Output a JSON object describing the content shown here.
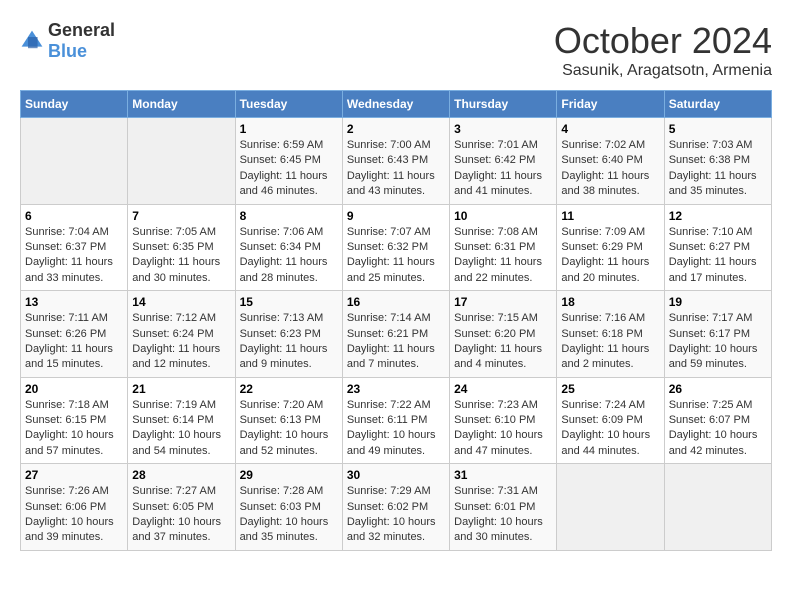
{
  "logo": {
    "general": "General",
    "blue": "Blue"
  },
  "title": "October 2024",
  "subtitle": "Sasunik, Aragatsotn, Armenia",
  "days_header": [
    "Sunday",
    "Monday",
    "Tuesday",
    "Wednesday",
    "Thursday",
    "Friday",
    "Saturday"
  ],
  "weeks": [
    [
      {
        "day": "",
        "empty": true
      },
      {
        "day": "",
        "empty": true
      },
      {
        "day": "1",
        "sunrise": "Sunrise: 6:59 AM",
        "sunset": "Sunset: 6:45 PM",
        "daylight": "Daylight: 11 hours and 46 minutes."
      },
      {
        "day": "2",
        "sunrise": "Sunrise: 7:00 AM",
        "sunset": "Sunset: 6:43 PM",
        "daylight": "Daylight: 11 hours and 43 minutes."
      },
      {
        "day": "3",
        "sunrise": "Sunrise: 7:01 AM",
        "sunset": "Sunset: 6:42 PM",
        "daylight": "Daylight: 11 hours and 41 minutes."
      },
      {
        "day": "4",
        "sunrise": "Sunrise: 7:02 AM",
        "sunset": "Sunset: 6:40 PM",
        "daylight": "Daylight: 11 hours and 38 minutes."
      },
      {
        "day": "5",
        "sunrise": "Sunrise: 7:03 AM",
        "sunset": "Sunset: 6:38 PM",
        "daylight": "Daylight: 11 hours and 35 minutes."
      }
    ],
    [
      {
        "day": "6",
        "sunrise": "Sunrise: 7:04 AM",
        "sunset": "Sunset: 6:37 PM",
        "daylight": "Daylight: 11 hours and 33 minutes."
      },
      {
        "day": "7",
        "sunrise": "Sunrise: 7:05 AM",
        "sunset": "Sunset: 6:35 PM",
        "daylight": "Daylight: 11 hours and 30 minutes."
      },
      {
        "day": "8",
        "sunrise": "Sunrise: 7:06 AM",
        "sunset": "Sunset: 6:34 PM",
        "daylight": "Daylight: 11 hours and 28 minutes."
      },
      {
        "day": "9",
        "sunrise": "Sunrise: 7:07 AM",
        "sunset": "Sunset: 6:32 PM",
        "daylight": "Daylight: 11 hours and 25 minutes."
      },
      {
        "day": "10",
        "sunrise": "Sunrise: 7:08 AM",
        "sunset": "Sunset: 6:31 PM",
        "daylight": "Daylight: 11 hours and 22 minutes."
      },
      {
        "day": "11",
        "sunrise": "Sunrise: 7:09 AM",
        "sunset": "Sunset: 6:29 PM",
        "daylight": "Daylight: 11 hours and 20 minutes."
      },
      {
        "day": "12",
        "sunrise": "Sunrise: 7:10 AM",
        "sunset": "Sunset: 6:27 PM",
        "daylight": "Daylight: 11 hours and 17 minutes."
      }
    ],
    [
      {
        "day": "13",
        "sunrise": "Sunrise: 7:11 AM",
        "sunset": "Sunset: 6:26 PM",
        "daylight": "Daylight: 11 hours and 15 minutes."
      },
      {
        "day": "14",
        "sunrise": "Sunrise: 7:12 AM",
        "sunset": "Sunset: 6:24 PM",
        "daylight": "Daylight: 11 hours and 12 minutes."
      },
      {
        "day": "15",
        "sunrise": "Sunrise: 7:13 AM",
        "sunset": "Sunset: 6:23 PM",
        "daylight": "Daylight: 11 hours and 9 minutes."
      },
      {
        "day": "16",
        "sunrise": "Sunrise: 7:14 AM",
        "sunset": "Sunset: 6:21 PM",
        "daylight": "Daylight: 11 hours and 7 minutes."
      },
      {
        "day": "17",
        "sunrise": "Sunrise: 7:15 AM",
        "sunset": "Sunset: 6:20 PM",
        "daylight": "Daylight: 11 hours and 4 minutes."
      },
      {
        "day": "18",
        "sunrise": "Sunrise: 7:16 AM",
        "sunset": "Sunset: 6:18 PM",
        "daylight": "Daylight: 11 hours and 2 minutes."
      },
      {
        "day": "19",
        "sunrise": "Sunrise: 7:17 AM",
        "sunset": "Sunset: 6:17 PM",
        "daylight": "Daylight: 10 hours and 59 minutes."
      }
    ],
    [
      {
        "day": "20",
        "sunrise": "Sunrise: 7:18 AM",
        "sunset": "Sunset: 6:15 PM",
        "daylight": "Daylight: 10 hours and 57 minutes."
      },
      {
        "day": "21",
        "sunrise": "Sunrise: 7:19 AM",
        "sunset": "Sunset: 6:14 PM",
        "daylight": "Daylight: 10 hours and 54 minutes."
      },
      {
        "day": "22",
        "sunrise": "Sunrise: 7:20 AM",
        "sunset": "Sunset: 6:13 PM",
        "daylight": "Daylight: 10 hours and 52 minutes."
      },
      {
        "day": "23",
        "sunrise": "Sunrise: 7:22 AM",
        "sunset": "Sunset: 6:11 PM",
        "daylight": "Daylight: 10 hours and 49 minutes."
      },
      {
        "day": "24",
        "sunrise": "Sunrise: 7:23 AM",
        "sunset": "Sunset: 6:10 PM",
        "daylight": "Daylight: 10 hours and 47 minutes."
      },
      {
        "day": "25",
        "sunrise": "Sunrise: 7:24 AM",
        "sunset": "Sunset: 6:09 PM",
        "daylight": "Daylight: 10 hours and 44 minutes."
      },
      {
        "day": "26",
        "sunrise": "Sunrise: 7:25 AM",
        "sunset": "Sunset: 6:07 PM",
        "daylight": "Daylight: 10 hours and 42 minutes."
      }
    ],
    [
      {
        "day": "27",
        "sunrise": "Sunrise: 7:26 AM",
        "sunset": "Sunset: 6:06 PM",
        "daylight": "Daylight: 10 hours and 39 minutes."
      },
      {
        "day": "28",
        "sunrise": "Sunrise: 7:27 AM",
        "sunset": "Sunset: 6:05 PM",
        "daylight": "Daylight: 10 hours and 37 minutes."
      },
      {
        "day": "29",
        "sunrise": "Sunrise: 7:28 AM",
        "sunset": "Sunset: 6:03 PM",
        "daylight": "Daylight: 10 hours and 35 minutes."
      },
      {
        "day": "30",
        "sunrise": "Sunrise: 7:29 AM",
        "sunset": "Sunset: 6:02 PM",
        "daylight": "Daylight: 10 hours and 32 minutes."
      },
      {
        "day": "31",
        "sunrise": "Sunrise: 7:31 AM",
        "sunset": "Sunset: 6:01 PM",
        "daylight": "Daylight: 10 hours and 30 minutes."
      },
      {
        "day": "",
        "empty": true
      },
      {
        "day": "",
        "empty": true
      }
    ]
  ]
}
